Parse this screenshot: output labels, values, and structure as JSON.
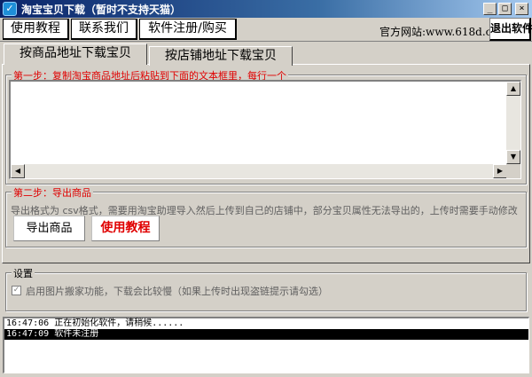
{
  "window": {
    "title": "淘宝宝贝下载（暂时不支持天猫）",
    "icon": "app-shield-icon",
    "controls": [
      "minimize-icon",
      "maximize-icon",
      "close-icon"
    ]
  },
  "toolbar": {
    "tutorial_label": "使用教程",
    "contact_label": "联系我们",
    "register_label": "软件注册/购买",
    "site_label": "官方网站:www.618d.com",
    "exit_label": "退出软件"
  },
  "tabs": [
    {
      "label": "按商品地址下载宝贝",
      "active": true
    },
    {
      "label": "按店铺地址下载宝贝",
      "active": false
    }
  ],
  "step1": {
    "legend": "第一步：复制淘宝商品地址后粘贴到下面的文本框里，每行一个",
    "value": ""
  },
  "step2": {
    "legend": "第二步：导出商品",
    "hint": "导出格式为 csv格式，需要用淘宝助理导入然后上传到自己的店铺中，部分宝贝属性无法导出的，上传时需要手动修改",
    "export_label": "导出商品",
    "tutorial_label": "使用教程"
  },
  "settings": {
    "legend": "设置",
    "checkbox_label": "启用图片搬家功能，下载会比较慢（如果上传时出现盗链提示请勾选）",
    "checked": true
  },
  "log": [
    {
      "time": "16:47:06",
      "message": "正在初始化软件，请稍候......"
    },
    {
      "time": "16:47:09",
      "message": "软件未注册"
    }
  ],
  "colors": {
    "accent_red": "#e00000",
    "titlebar_start": "#0a246a",
    "face": "#d4d0c8"
  }
}
